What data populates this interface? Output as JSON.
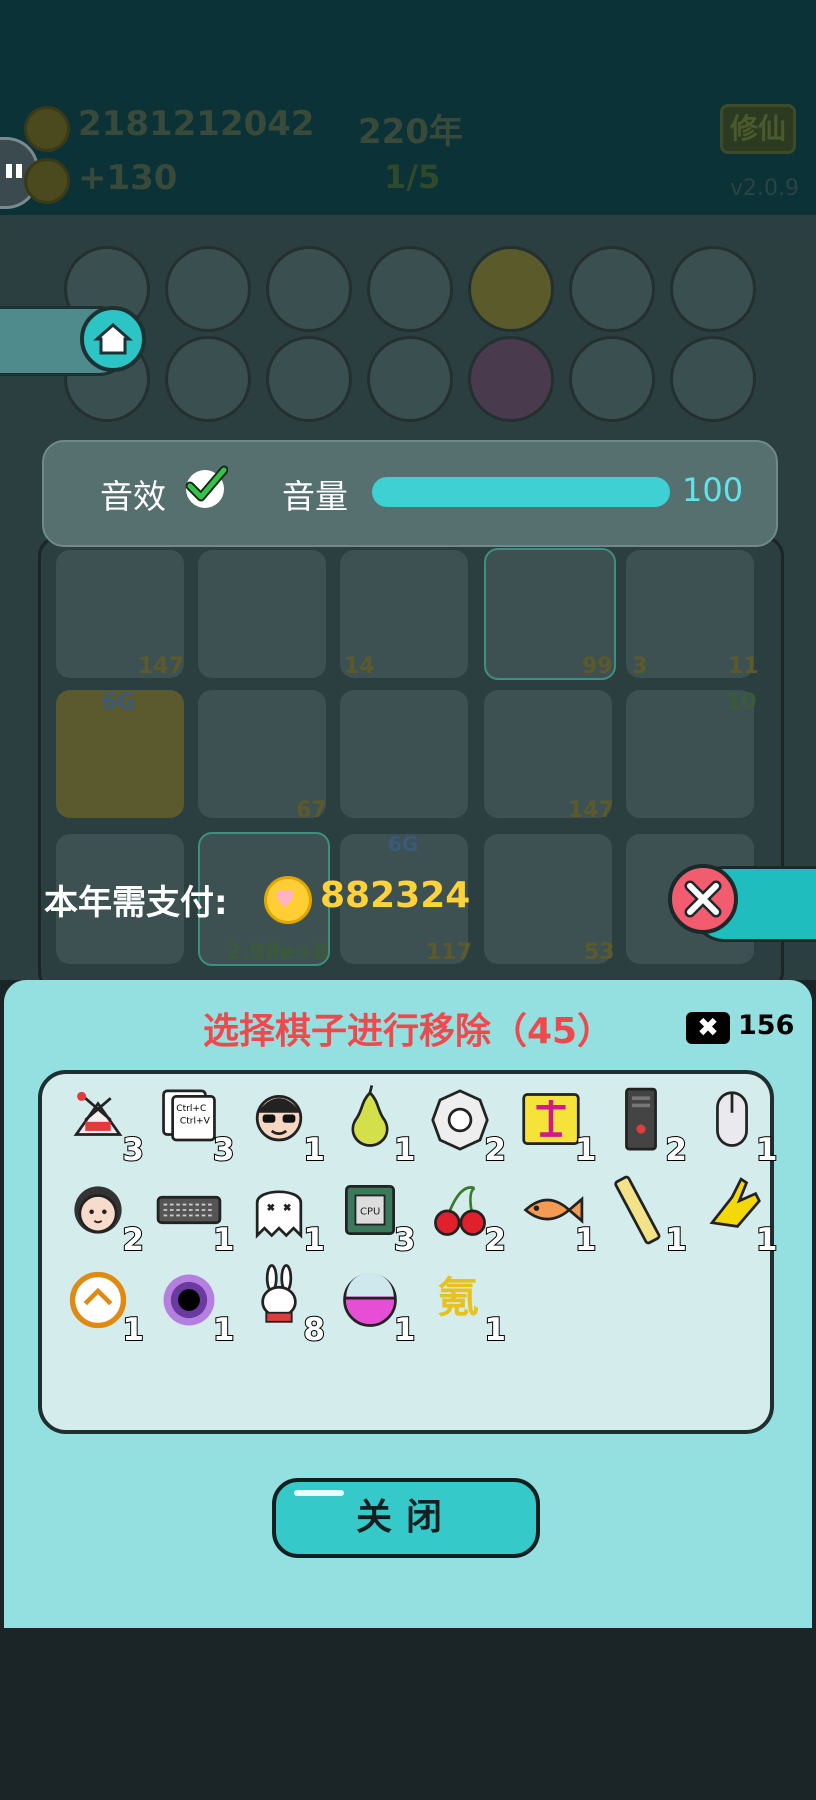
{
  "header": {
    "coins": "2181212042",
    "year": "220年",
    "income": "+130",
    "round": "1/5",
    "cultivate_button": "修仙",
    "version": "v2.0.9"
  },
  "sound_panel": {
    "sfx_label": "音效",
    "volume_label": "音量",
    "volume_value": "100"
  },
  "board": {
    "cell_numbers": [
      "147",
      "14",
      "99",
      "3",
      "11",
      "67",
      "147",
      "10",
      "6G",
      "2.98e+8",
      "117",
      "53",
      "6G"
    ]
  },
  "payment": {
    "label": "本年需支付:",
    "value": "882324"
  },
  "dialog": {
    "title": "选择棋子进行移除（45）",
    "remove_count": "156",
    "pieces": [
      {
        "icon": "rabbit-bag-icon",
        "count": "3"
      },
      {
        "icon": "ctrl-c-ctrl-v-icon",
        "count": "3"
      },
      {
        "icon": "sunglasses-man-icon",
        "count": "1"
      },
      {
        "icon": "pear-icon",
        "count": "1"
      },
      {
        "icon": "bagua-icon",
        "count": "2"
      },
      {
        "icon": "scale-icon",
        "count": "1"
      },
      {
        "icon": "pc-tower-icon",
        "count": "2"
      },
      {
        "icon": "mouse-icon",
        "count": "1"
      },
      {
        "icon": "woman-face-icon",
        "count": "2"
      },
      {
        "icon": "keyboard-icon",
        "count": "1"
      },
      {
        "icon": "ghost-icon",
        "count": "1"
      },
      {
        "icon": "cpu-icon",
        "count": "3"
      },
      {
        "icon": "cherry-icon",
        "count": "2"
      },
      {
        "icon": "fish-icon",
        "count": "1"
      },
      {
        "icon": "ruler-icon",
        "count": "1"
      },
      {
        "icon": "yellow-hand-icon",
        "count": "1"
      },
      {
        "icon": "recycle-coin-icon",
        "count": "1"
      },
      {
        "icon": "black-hole-icon",
        "count": "1"
      },
      {
        "icon": "rabbit-icon",
        "count": "8"
      },
      {
        "icon": "capsule-ball-icon",
        "count": "1"
      },
      {
        "icon": "krypton-icon",
        "count": "1"
      }
    ],
    "krypton_glyph": "氪",
    "close_label": "关闭"
  },
  "colors": {
    "dialog_bg": "#94dfdf",
    "title_red": "#ee4a4e",
    "accent_teal": "#35c9c9",
    "coin_gold": "#ffd23a"
  }
}
